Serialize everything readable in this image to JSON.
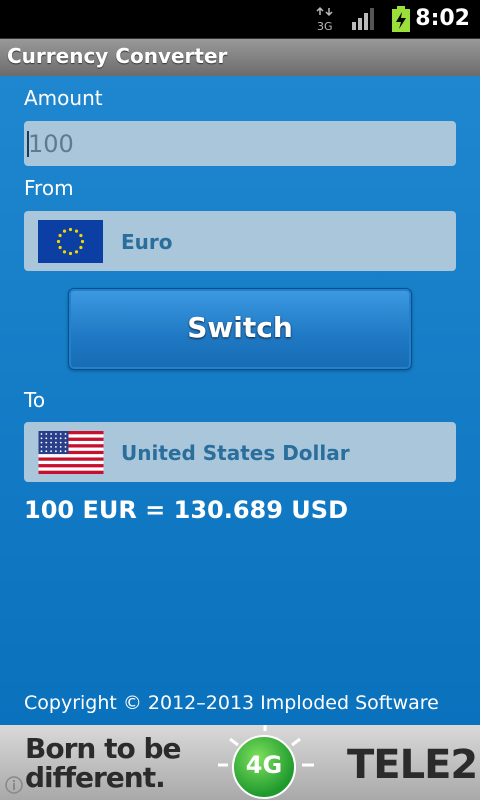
{
  "status_bar": {
    "network": "3G",
    "time": "8:02"
  },
  "app": {
    "title": "Currency Converter"
  },
  "amount": {
    "label": "Amount",
    "value": "100"
  },
  "from": {
    "label": "From",
    "currency": "Euro",
    "flag_icon": "eu-flag-icon"
  },
  "switch_button": {
    "label": "Switch"
  },
  "to": {
    "label": "To",
    "currency": "United States Dollar",
    "flag_icon": "us-flag-icon"
  },
  "result": "100 EUR = 130.689 USD",
  "copyright": "Copyright © 2012–2013 Imploded Software",
  "ad": {
    "line1": "Born to be",
    "line2": "different.",
    "badge": "4G",
    "brand": "TELE2"
  },
  "colors": {
    "background": "#0a72bd",
    "field": "#aac6da",
    "currency_text": "#2a6e9c",
    "button": "#1f78c3"
  }
}
